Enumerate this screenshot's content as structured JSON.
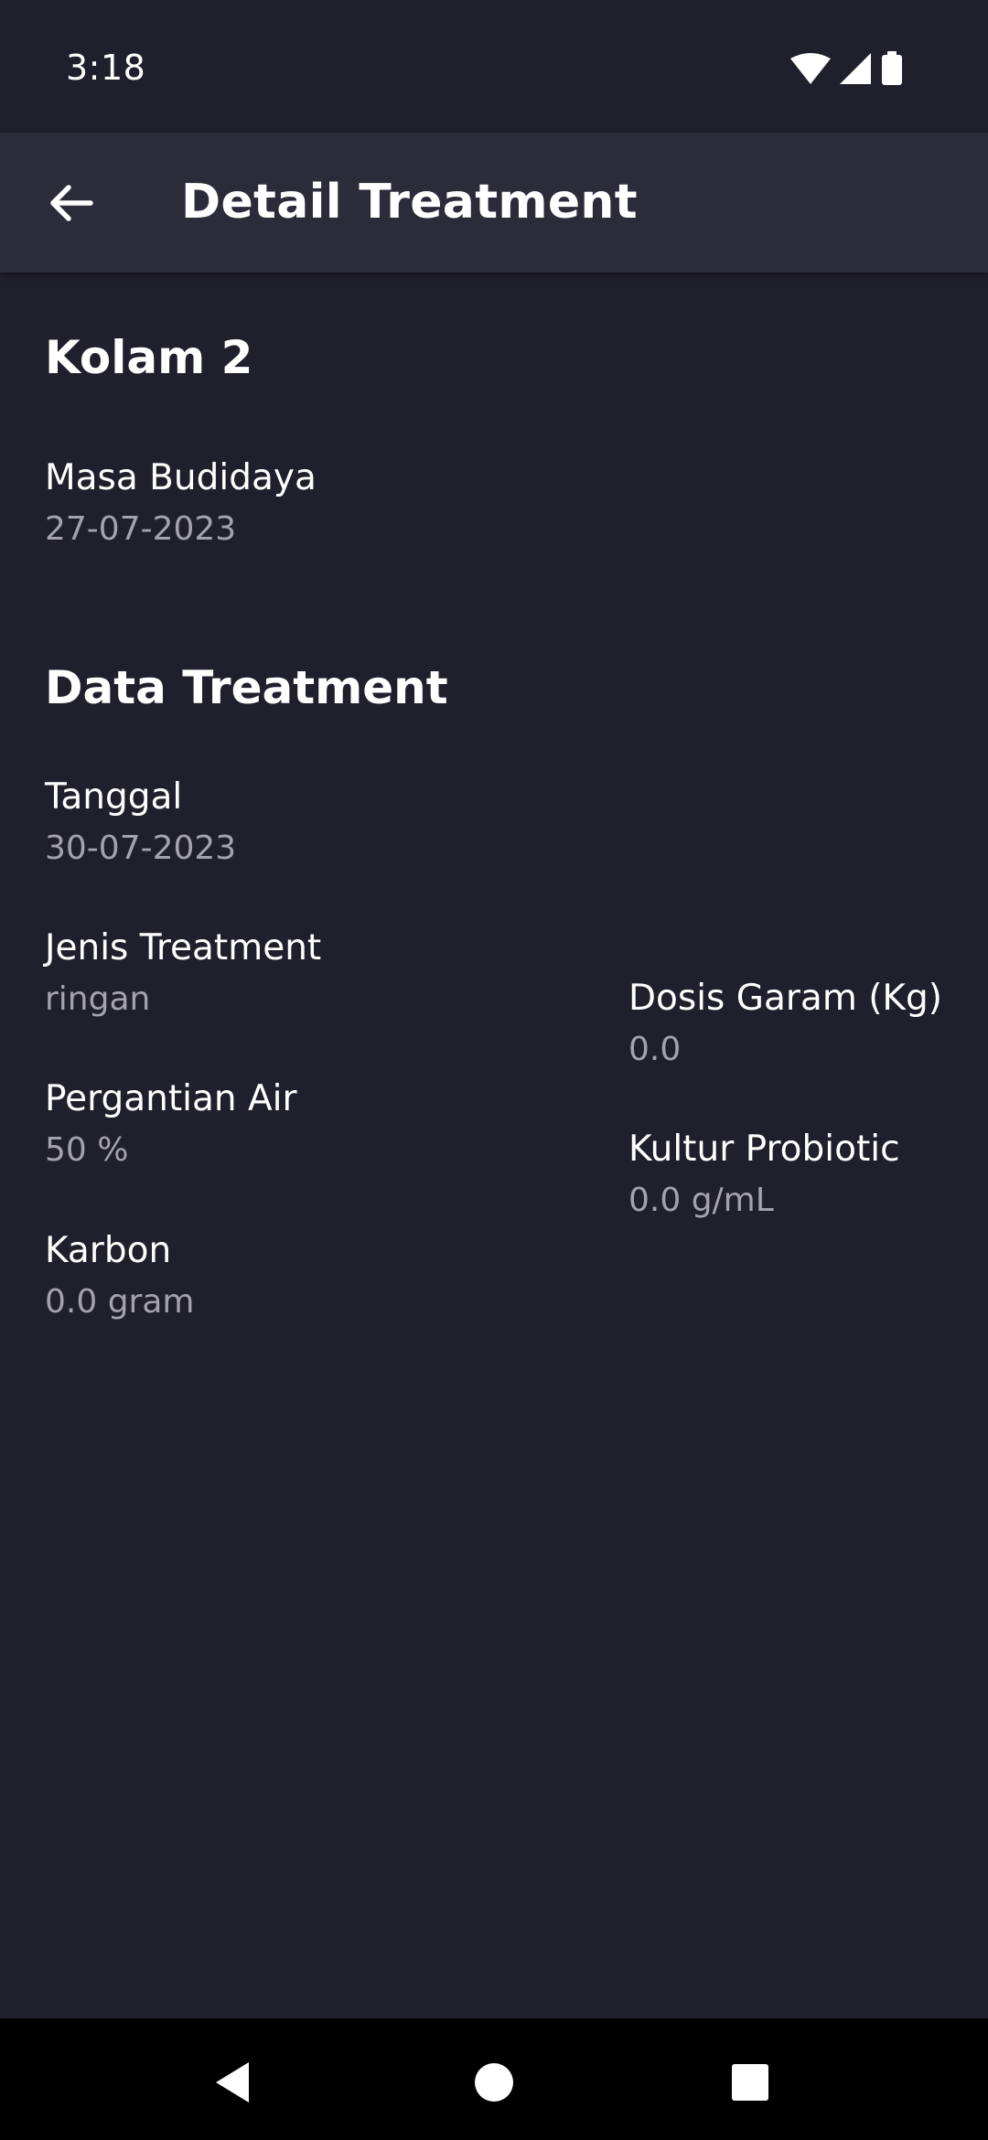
{
  "status_bar": {
    "time": "3:18",
    "icons": [
      "wifi-icon",
      "signal-icon",
      "battery-icon"
    ]
  },
  "app_bar": {
    "title": "Detail Treatment",
    "back_icon": "arrow-left-icon"
  },
  "pond": {
    "name": "Kolam 2",
    "masa_budidaya_label": "Masa Budidaya",
    "masa_budidaya_value": "27-07-2023"
  },
  "treatment": {
    "heading": "Data Treatment",
    "tanggal_label": "Tanggal",
    "tanggal_value": "30-07-2023",
    "jenis_label": "Jenis Treatment",
    "jenis_value": "ringan",
    "pergantian_label": "Pergantian Air",
    "pergantian_value": "50 %",
    "karbon_label": "Karbon",
    "karbon_value": "0.0 gram",
    "dosis_label": "Dosis Garam (Kg)",
    "dosis_value": "0.0",
    "kultur_label": "Kultur Probiotic",
    "kultur_value": "0.0 g/mL"
  },
  "colors": {
    "background": "#201f2c",
    "app_bar": "#2c2b39",
    "text_primary": "#ffffff",
    "text_secondary": "#a3a2ad"
  },
  "nav_bar": {
    "icons": [
      "back-triangle-icon",
      "home-circle-icon",
      "recents-square-icon"
    ]
  }
}
